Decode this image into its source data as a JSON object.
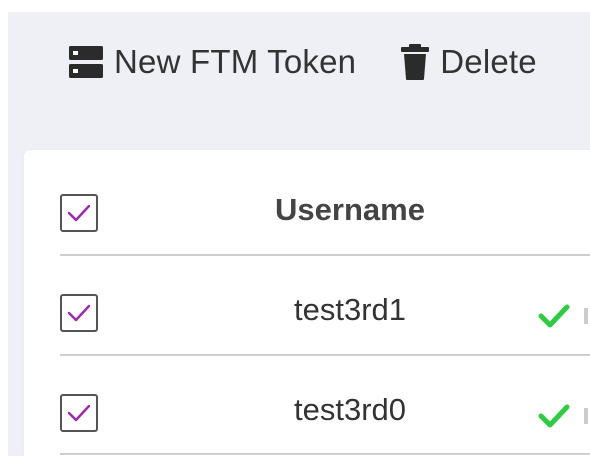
{
  "toolbar": {
    "new_token_label": "New FTM Token",
    "delete_label": "Delete",
    "new_token_icon": "server-icon",
    "delete_icon": "trash-icon"
  },
  "table": {
    "columns": [
      "Username"
    ],
    "header_checked": true,
    "rows": [
      {
        "username": "test3rd1",
        "checked": true,
        "status": "check-icon"
      },
      {
        "username": "test3rd0",
        "checked": true,
        "status": "check-icon"
      }
    ]
  },
  "colors": {
    "accent_purple": "#9c27b0",
    "status_green": "#2ecc40",
    "toolbar_bg": "#eef0f5"
  }
}
